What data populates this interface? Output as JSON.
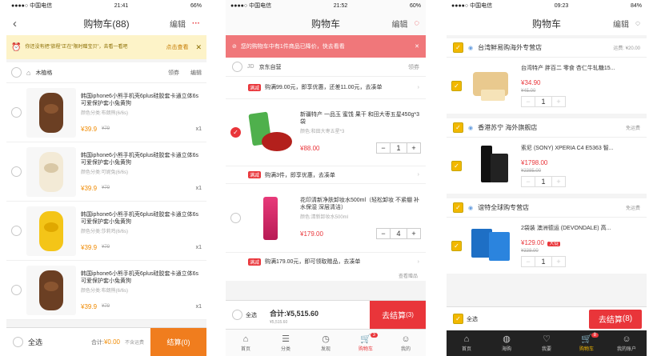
{
  "p1": {
    "status": {
      "carrier": "●●●●○ 中国电信",
      "time": "21:41",
      "battery": "66%"
    },
    "title": "购物车(88)",
    "edit": "编辑",
    "more": "···",
    "banner": {
      "text": "你还没有把“旅程”正在“限时赠宝贝”，去看一看吧",
      "action": "点击查看",
      "close": "✕"
    },
    "shop": {
      "name": "木植格",
      "coupon": "领券",
      "edit": "编辑"
    },
    "items": [
      {
        "title": "韩国iphone6小熊手机壳6plus硅胶套卡通立体6s可爱保护套小兔黄狗",
        "sku": "颜色分类:布朗熊(6/6s)",
        "price": "¥39.9",
        "old": "¥79",
        "qty": "x1"
      },
      {
        "title": "韩国iphone6小熊手机壳6plus硅胶套卡通立体6s可爱保护套小兔黄狗",
        "sku": "颜色分类:可妮兔(6/6s)",
        "price": "¥39.9",
        "old": "¥79",
        "qty": "x1"
      },
      {
        "title": "韩国iphone6小熊手机壳6plus硅胶套卡通立体6s可爱保护套小兔黄狗",
        "sku": "颜色分类:莎莉鸡(6/6s)",
        "price": "¥39.9",
        "old": "¥79",
        "qty": "x1"
      },
      {
        "title": "韩国iphone6小熊手机壳6plus硅胶套卡通立体6s可爱保护套小兔黄狗",
        "sku": "颜色分类:布朗熊(6/6s)",
        "price": "¥39.9",
        "old": "¥79",
        "qty": "x1"
      }
    ],
    "footer": {
      "select_all": "全选",
      "total_label": "合计:",
      "total": "¥0.00",
      "shipping": "不含运费",
      "checkout": "结算(0)"
    }
  },
  "p2": {
    "status": {
      "carrier": "●●●●○ 中国电信",
      "time": "21:52",
      "battery": "60%"
    },
    "title": "购物车",
    "edit": "编辑",
    "notice": "您的购物车中有1件商品已降价，快去看看",
    "shop": {
      "name": "京东自营",
      "coupon": "领券"
    },
    "promos": [
      {
        "tag": "满减",
        "text": "购满99.00元，即享优惠，还差11.00元，去凑单"
      },
      {
        "tag": "满减",
        "text": "购满3件，即享优惠，去凑单"
      },
      {
        "tag": "满减",
        "text": "购满179.00元，即可领取赠品，去凑单"
      }
    ],
    "items": [
      {
        "title": "新疆特产 一品玉 蜜饯 果干 和田大枣五星450g*3袋",
        "sku": "颜色:和田大枣五星*3",
        "price": "¥88.00",
        "qty": "1"
      },
      {
        "title": "花印清新净肤卸妆水500ml（轻松卸妆 不紧绷 补水保湿 深层清洁）",
        "sku": "颜色:清新卸妆水500ml",
        "price": "¥179.00",
        "qty": "4"
      }
    ],
    "gift": "查看赠品",
    "footer": {
      "select_all": "全选",
      "total_label": "合计:",
      "total": "¥5,515.60",
      "sub": "¥5,515.60",
      "checkout": "去结算",
      "count": "(3)"
    },
    "tabs": [
      "首页",
      "分类",
      "发现",
      "购物车",
      "我的"
    ],
    "cart_badge": "3"
  },
  "p3": {
    "status": {
      "carrier": "●●●●○ 中国电信",
      "time": "09:23",
      "battery": "84%"
    },
    "title": "购物车",
    "edit": "编辑",
    "shops": [
      {
        "name": "台湾鲜易购海外专营店",
        "ship": "运费: ¥20.00",
        "title": "台湾特产 胖百二 零食 杏仁牛轧糖15...",
        "price": "¥34.90",
        "old": "¥45.00",
        "qty": "1"
      },
      {
        "name": "香港苏宁 海外旗舰店",
        "ship": "免运费",
        "title": "索尼 (SONY) XPERIA C4 E5363 智...",
        "price": "¥1798.00",
        "old": "¥2385.00",
        "qty": "1"
      },
      {
        "name": "谊特全球购专营店",
        "ship": "免运费",
        "title": "2袋装 澳洲德运 (DEVONDALE) 高...",
        "price": "¥129.00",
        "old": "¥338.00",
        "tag": "大促",
        "qty": "1"
      }
    ],
    "footer": {
      "select_all": "全选",
      "checkout": "去结算",
      "count": "(8)"
    },
    "tabs": [
      "首页",
      "海购",
      "我要",
      "购物车",
      "我的账户"
    ],
    "cart_badge": "8"
  }
}
